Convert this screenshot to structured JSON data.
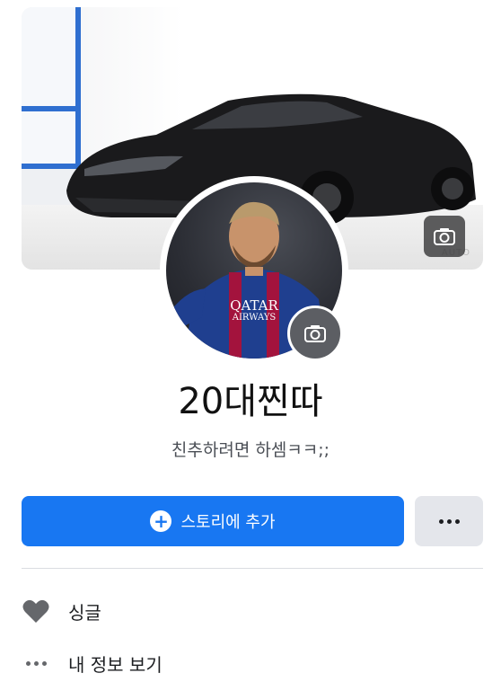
{
  "profile": {
    "name": "20대찐따",
    "bio": "친추하려면 하셈ㅋㅋ;;",
    "cover_watermark": "AUTO"
  },
  "actions": {
    "add_story_label": "스토리에 추가",
    "plus_glyph": "+"
  },
  "intro": {
    "relationship": "싱글",
    "see_about": "내 정보 보기"
  },
  "avatar_jersey": {
    "sponsor_line1": "QATAR",
    "sponsor_line2": "AIRWAYS"
  },
  "colors": {
    "accent": "#1877f2",
    "secondary_button": "#e4e6eb",
    "icon_gray": "#65676b"
  },
  "icons": [
    "camera-icon",
    "plus-circle-icon",
    "more-dots-icon",
    "heart-icon",
    "ellipsis-icon"
  ]
}
